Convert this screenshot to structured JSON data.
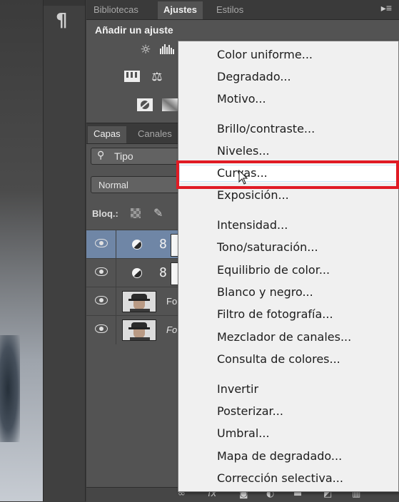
{
  "panel": {
    "tabs": [
      {
        "label": "Bibliotecas",
        "active": false
      },
      {
        "label": "Ajustes",
        "active": true
      },
      {
        "label": "Estilos",
        "active": false
      }
    ],
    "menu_icon": "panel-menu-icon",
    "adjustments_title": "Añadir un ajuste",
    "adjustment_icons": [
      "brightness-icon",
      "levels-icon",
      "channel-mixer-icon",
      "balance-icon",
      "photo-filter-icon",
      "gradient-map-icon"
    ]
  },
  "layers": {
    "tabs": [
      {
        "label": "Capas",
        "active": true
      },
      {
        "label": "Canales",
        "active": false
      }
    ],
    "search_prefix_icon": "search-icon",
    "search_value": "Tipo",
    "blend_mode": "Normal",
    "lock_label": "Bloq.:",
    "rows": [
      {
        "type": "adjustment",
        "selected": true,
        "name": ""
      },
      {
        "type": "adjustment",
        "selected": false,
        "name": ""
      },
      {
        "type": "photo",
        "selected": false,
        "name": "Fo",
        "italic": false
      },
      {
        "type": "photo",
        "selected": false,
        "name": "Fo",
        "italic": true
      }
    ],
    "bottom_icons": [
      "link-icon",
      "fx-icon",
      "mask-icon",
      "new-adjustment-icon",
      "group-icon",
      "new-layer-icon",
      "trash-icon"
    ],
    "fx_label": "fx"
  },
  "dropdown_menu": {
    "items": [
      {
        "label": "Color uniforme...",
        "hovered": false
      },
      {
        "label": "Degradado...",
        "hovered": false
      },
      {
        "label": "Motivo...",
        "hovered": false
      },
      {
        "label": "Brillo/contraste...",
        "hovered": false
      },
      {
        "label": "Niveles...",
        "hovered": false
      },
      {
        "label": "Curvas...",
        "hovered": true
      },
      {
        "label": "Exposición...",
        "hovered": false
      },
      {
        "label": "Intensidad...",
        "hovered": false
      },
      {
        "label": "Tono/saturación...",
        "hovered": false
      },
      {
        "label": "Equilibrio de color...",
        "hovered": false
      },
      {
        "label": "Blanco y negro...",
        "hovered": false
      },
      {
        "label": "Filtro de fotografía...",
        "hovered": false
      },
      {
        "label": "Mezclador de canales...",
        "hovered": false
      },
      {
        "label": "Consulta de colores...",
        "hovered": false
      },
      {
        "label": "Invertir",
        "hovered": false
      },
      {
        "label": "Posterizar...",
        "hovered": false
      },
      {
        "label": "Umbral...",
        "hovered": false
      },
      {
        "label": "Mapa de degradado...",
        "hovered": false
      },
      {
        "label": "Corrección selectiva...",
        "hovered": false
      }
    ]
  },
  "annotation_color": "#e01b24",
  "selection_color": "#6f86a6"
}
